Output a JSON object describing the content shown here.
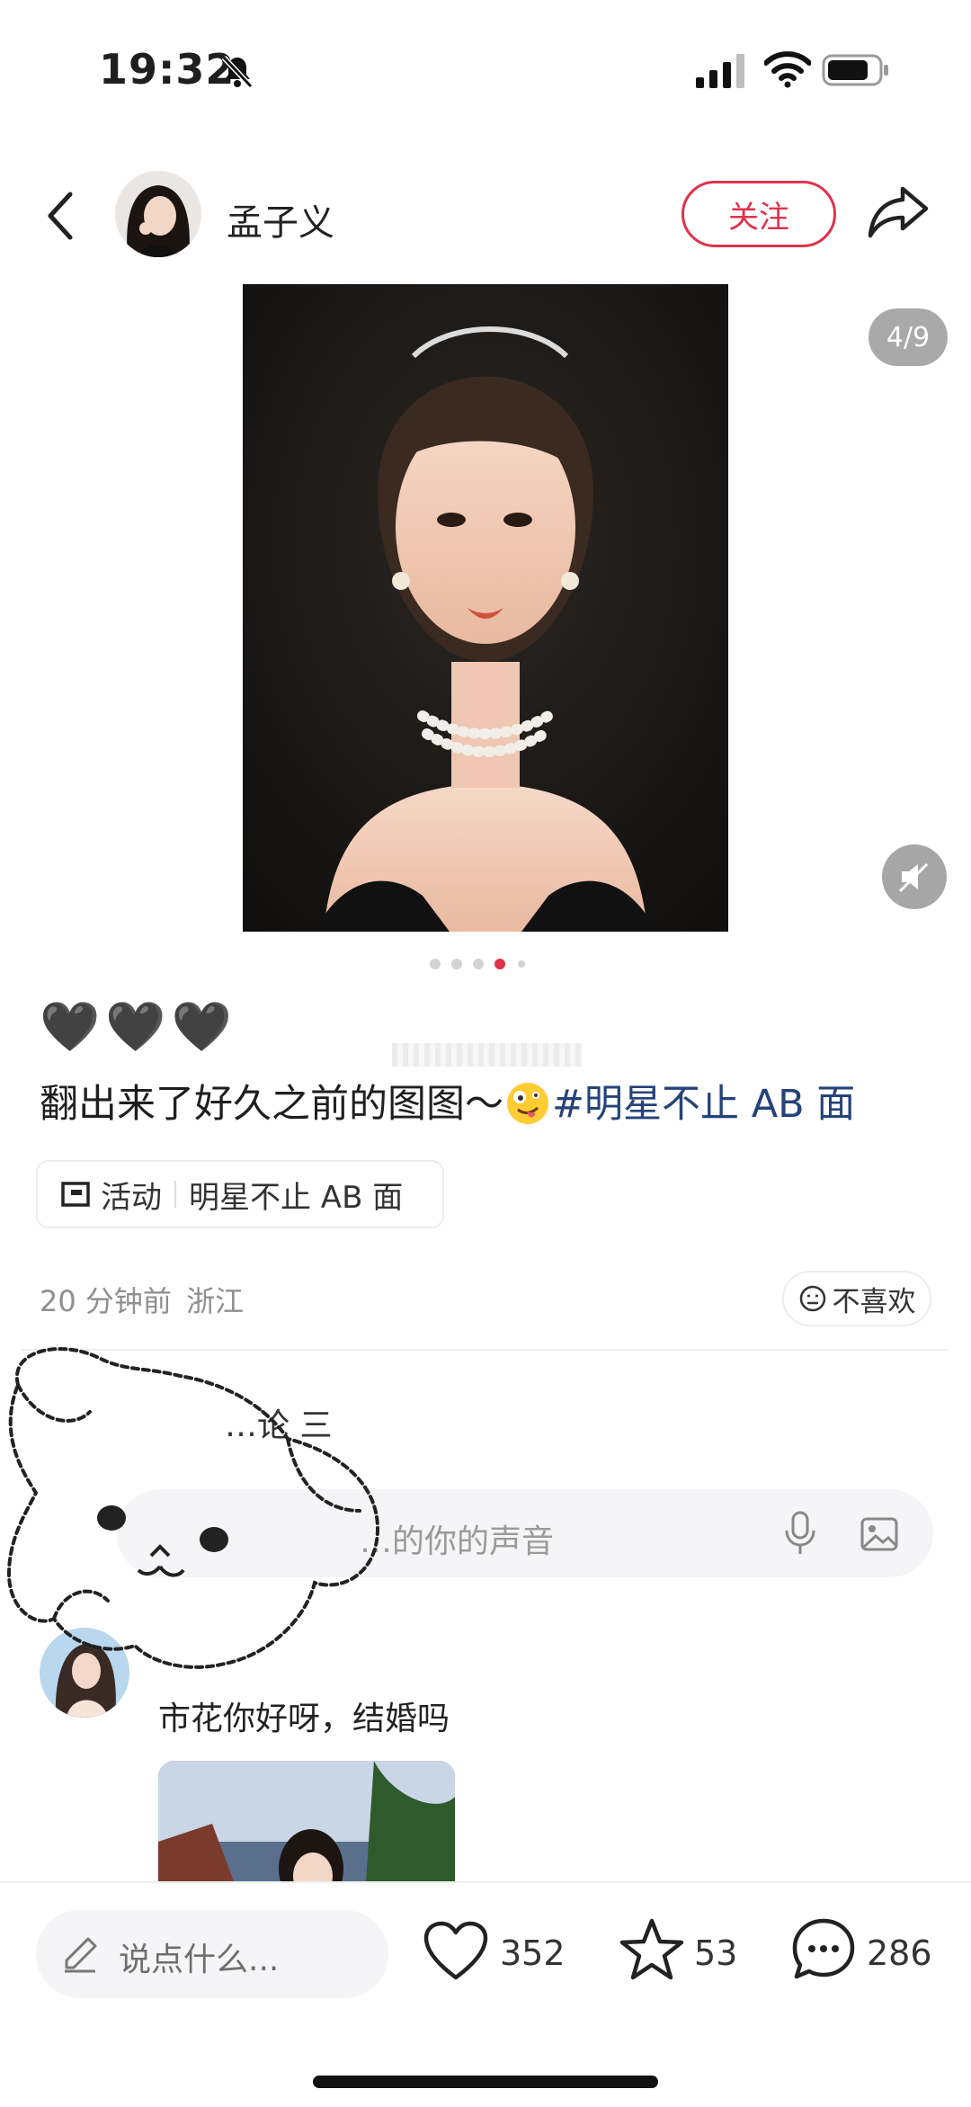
{
  "status_bar": {
    "time": "19:32"
  },
  "header": {
    "username": "孟子义",
    "follow_label": "关注"
  },
  "gallery": {
    "page_counter": "4/9",
    "total_dots": 5,
    "active_dot": 3
  },
  "post": {
    "hearts": "🖤🖤🖤",
    "caption_text": "翻出来了好久之前的图图～",
    "caption_tag": "#明星不止 AB 面",
    "activity_label": "活动",
    "activity_topic": "明星不止 AB 面",
    "timestamp": "20 分钟前",
    "location": "浙江",
    "dislike_label": "不喜欢"
  },
  "comments": {
    "count_label": "…论 三",
    "input_placeholder": "…的你的声音",
    "items": [
      {
        "text": "市花你好呀，结婚吗"
      }
    ]
  },
  "bottom_bar": {
    "say_placeholder": "说点什么...",
    "likes": "352",
    "favorites": "53",
    "comments": "286"
  },
  "colors": {
    "accent": "#e0324b",
    "tag": "#24437a",
    "text": "#1f1f1f",
    "muted": "#8f8f8f"
  }
}
